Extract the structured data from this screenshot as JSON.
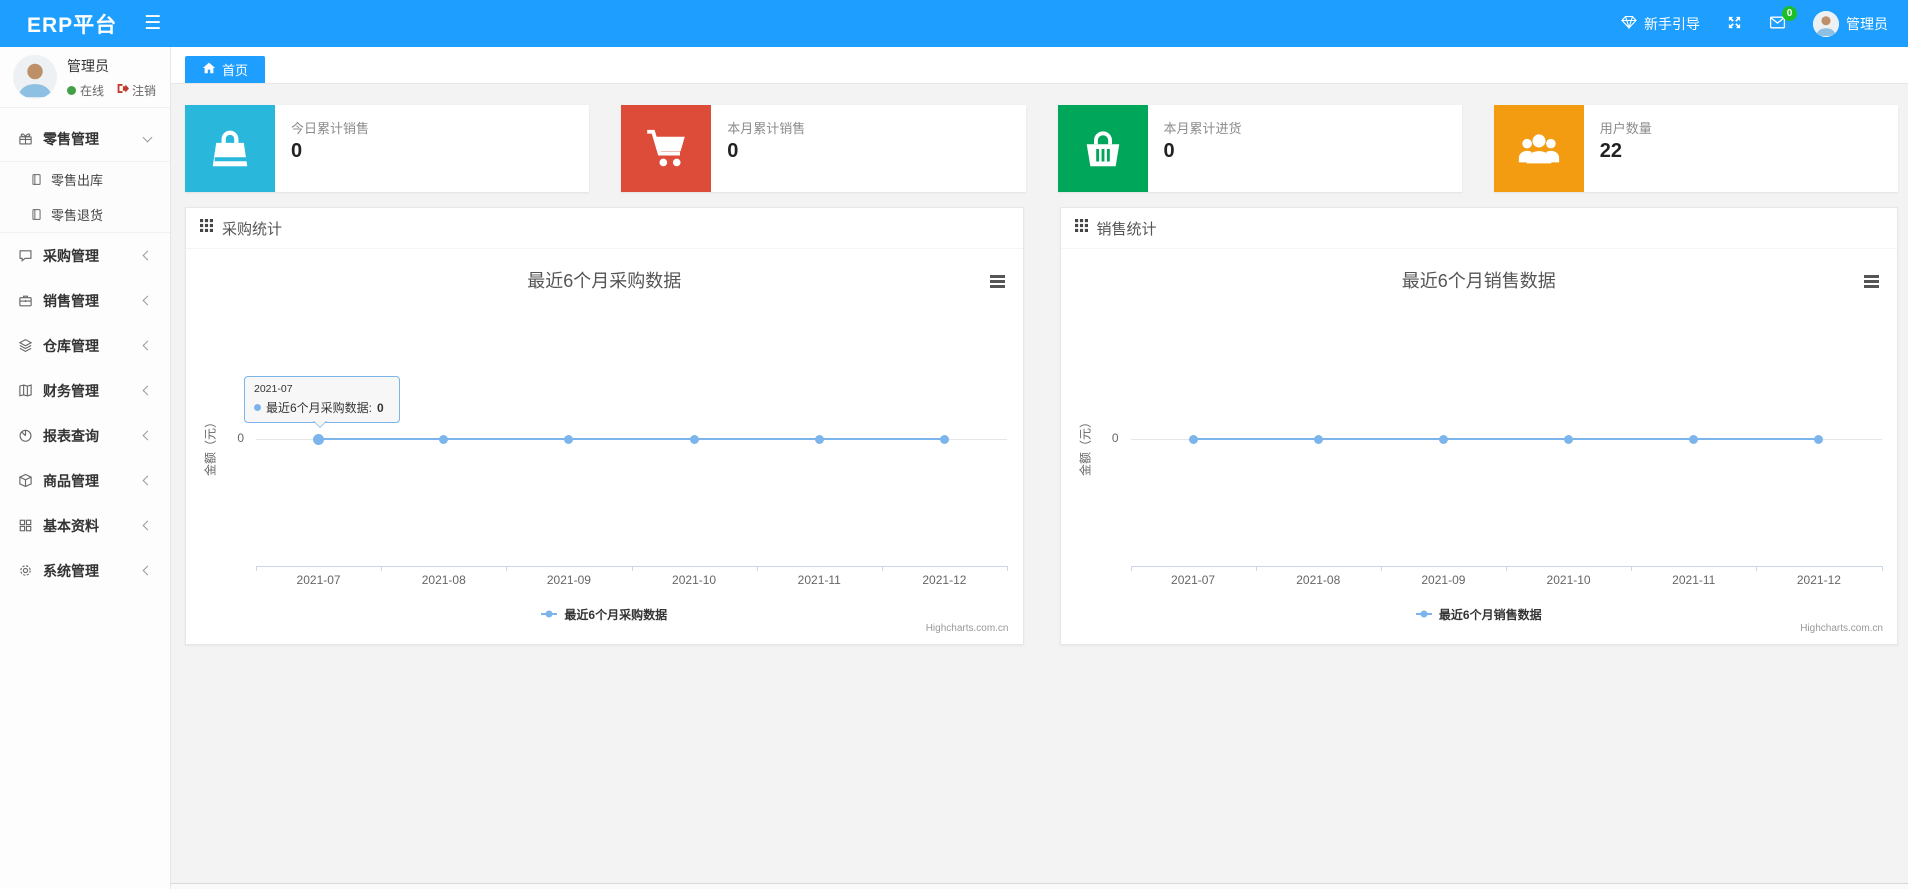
{
  "colors": {
    "primary": "#1e9fff",
    "badge": "#1ebe28",
    "status_online": "#43a047",
    "chart_line": "#7cb5ec"
  },
  "navbar": {
    "brand": "ERP平台",
    "guide": "新手引导",
    "mail_badge": "0",
    "username": "管理员"
  },
  "sidebar": {
    "user": {
      "name": "管理员",
      "status": "在线",
      "logout": "注销"
    },
    "menu": [
      {
        "label": "零售管理",
        "icon": "gift",
        "expanded": true,
        "children": [
          {
            "label": "零售出库",
            "icon": "doc"
          },
          {
            "label": "零售退货",
            "icon": "doc"
          }
        ]
      },
      {
        "label": "采购管理",
        "icon": "chat"
      },
      {
        "label": "销售管理",
        "icon": "briefcase"
      },
      {
        "label": "仓库管理",
        "icon": "layers"
      },
      {
        "label": "财务管理",
        "icon": "book"
      },
      {
        "label": "报表查询",
        "icon": "pie"
      },
      {
        "label": "商品管理",
        "icon": "box"
      },
      {
        "label": "基本资料",
        "icon": "grid"
      },
      {
        "label": "系统管理",
        "icon": "gear"
      }
    ]
  },
  "breadcrumb": {
    "home": "首页"
  },
  "cards": [
    {
      "title": "今日累计销售",
      "value": "0",
      "color": "#29b8db",
      "icon": "bag"
    },
    {
      "title": "本月累计销售",
      "value": "0",
      "color": "#dd4b39",
      "icon": "cart"
    },
    {
      "title": "本月累计进货",
      "value": "0",
      "color": "#00a65a",
      "icon": "basket"
    },
    {
      "title": "用户数量",
      "value": "22",
      "color": "#f39c12",
      "icon": "users"
    }
  ],
  "panels": [
    {
      "header": "采购统计"
    },
    {
      "header": "销售统计"
    }
  ],
  "chart_data": [
    {
      "type": "line",
      "title": "最近6个月采购数据",
      "categories": [
        "2021-07",
        "2021-08",
        "2021-09",
        "2021-10",
        "2021-11",
        "2021-12"
      ],
      "series": [
        {
          "name": "最近6个月采购数据",
          "values": [
            0,
            0,
            0,
            0,
            0,
            0
          ]
        }
      ],
      "ylabel": "金额（元）",
      "yticks": [
        "0"
      ],
      "line_color": "#7cb5ec",
      "legend_position": "bottom",
      "credits": "Highcharts.com.cn",
      "tooltip": {
        "visible": true,
        "category": "2021-07",
        "series": "最近6个月采购数据",
        "value": "0"
      }
    },
    {
      "type": "line",
      "title": "最近6个月销售数据",
      "categories": [
        "2021-07",
        "2021-08",
        "2021-09",
        "2021-10",
        "2021-11",
        "2021-12"
      ],
      "series": [
        {
          "name": "最近6个月销售数据",
          "values": [
            0,
            0,
            0,
            0,
            0,
            0
          ]
        }
      ],
      "ylabel": "金额（元）",
      "yticks": [
        "0"
      ],
      "line_color": "#7cb5ec",
      "legend_position": "bottom",
      "credits": "Highcharts.com.cn"
    }
  ]
}
